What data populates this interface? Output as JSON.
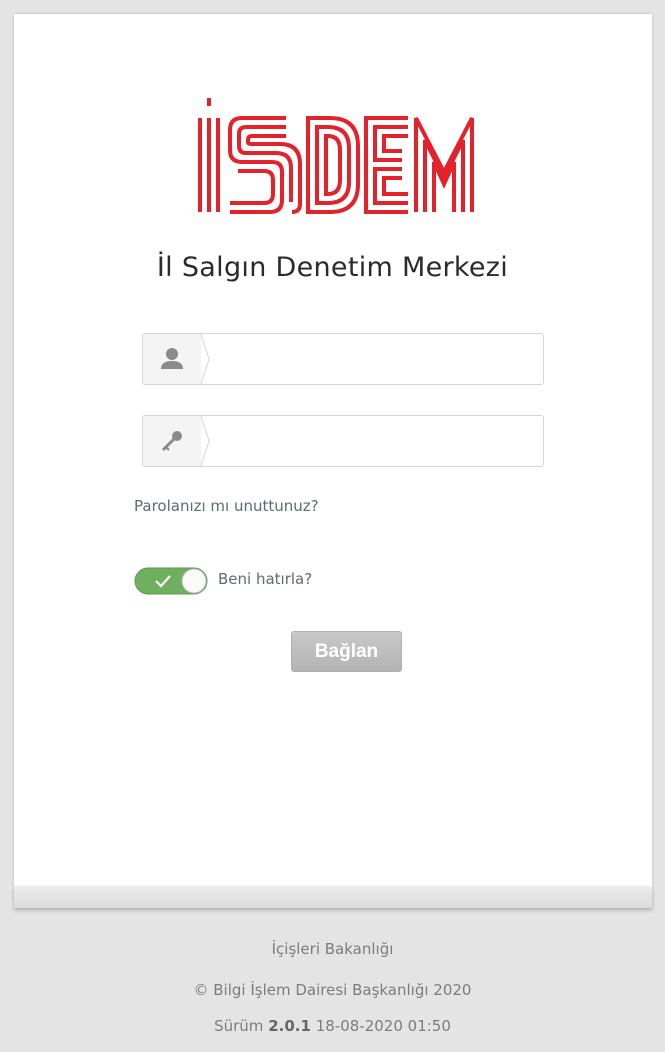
{
  "logo": {
    "text": "İSDEM",
    "color": "#e3232c"
  },
  "title": "İl Salgın Denetim Merkezi",
  "username": {
    "value": "",
    "placeholder": "",
    "icon": "user-icon"
  },
  "password": {
    "value": "",
    "placeholder": "",
    "icon": "key-icon"
  },
  "forgot_link": "Parolanızı mı unuttunuz?",
  "remember": {
    "label": "Beni hatırla?",
    "checked": true,
    "color": "#6fb060"
  },
  "login_button": "Bağlan",
  "footer": {
    "ministry": "İçişleri Bakanlığı",
    "copyright": "© Bilgi İşlem Dairesi Başkanlığı 2020",
    "version_label": "Sürüm",
    "version": "2.0.1",
    "build_date": "18-08-2020 01:50"
  }
}
